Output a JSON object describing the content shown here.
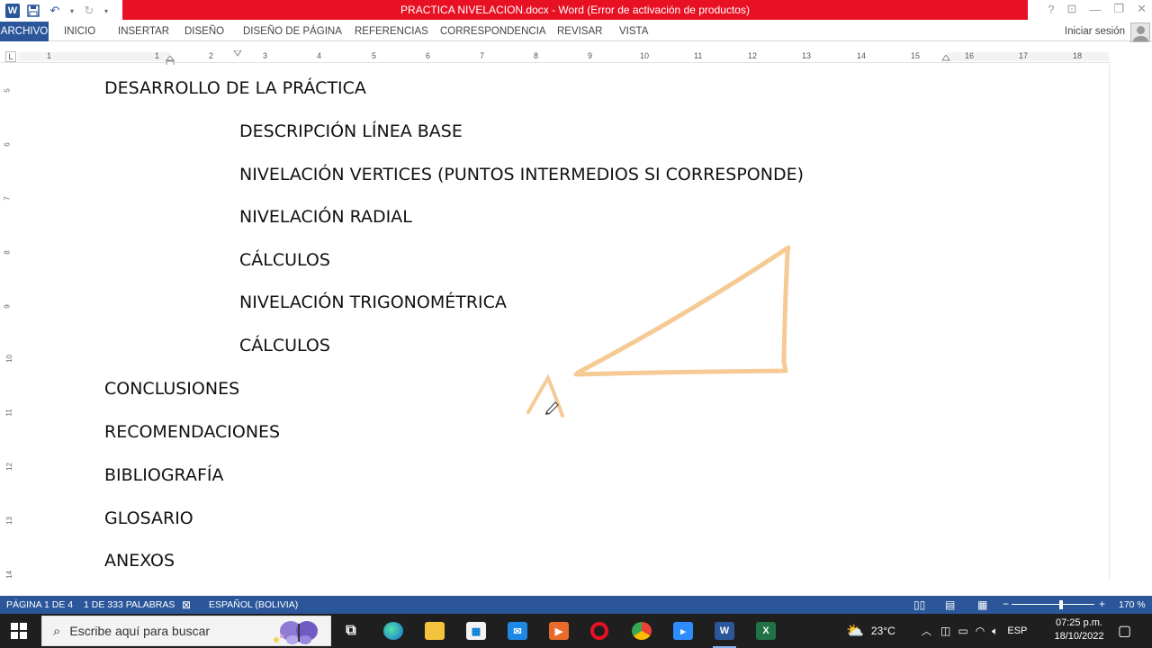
{
  "window": {
    "title": "PRACTICA NIVELACION.docx -  Word (Error de activación de productos)",
    "help": "?"
  },
  "ribbon": {
    "tabs": [
      "ARCHIVO",
      "INICIO",
      "INSERTAR",
      "DISEÑO",
      "DISEÑO DE PÁGINA",
      "REFERENCIAS",
      "CORRESPONDENCIA",
      "REVISAR",
      "VISTA"
    ],
    "signin": "Iniciar sesión"
  },
  "ruler": {
    "corner": "L",
    "numbers": [
      "1",
      "1",
      "2",
      "3",
      "4",
      "5",
      "6",
      "7",
      "8",
      "9",
      "10",
      "11",
      "12",
      "13",
      "14",
      "15",
      "16",
      "17",
      "18"
    ],
    "vertical_numbers": [
      "5",
      "6",
      "7",
      "8",
      "9",
      "10",
      "11",
      "12",
      "13",
      "14"
    ]
  },
  "document": {
    "lines": [
      {
        "text": "DESARROLLO DE LA PRÁCTICA",
        "level": 0
      },
      {
        "text": "DESCRIPCIÓN LÍNEA BASE",
        "level": 1
      },
      {
        "text": "NIVELACIÓN VERTICES (PUNTOS INTERMEDIOS SI CORRESPONDE)",
        "level": 1
      },
      {
        "text": "NIVELACIÓN RADIAL",
        "level": 1
      },
      {
        "text": "CÁLCULOS",
        "level": 1
      },
      {
        "text": "NIVELACIÓN TRIGONOMÉTRICA",
        "level": 1
      },
      {
        "text": "CÁLCULOS",
        "level": 1
      },
      {
        "text": "CONCLUSIONES",
        "level": 0
      },
      {
        "text": "RECOMENDACIONES",
        "level": 0
      },
      {
        "text": "BIBLIOGRAFÍA",
        "level": 0
      },
      {
        "text": "GLOSARIO",
        "level": 0
      },
      {
        "text": "ANEXOS",
        "level": 0
      }
    ],
    "ink_color": "#f5c48a"
  },
  "statusbar": {
    "page": "PÁGINA 1 DE 4",
    "words": "1 DE 333 PALABRAS",
    "language": "ESPAÑOL (BOLIVIA)",
    "zoom_minus": "−",
    "zoom_plus": "+",
    "zoom": "170 %"
  },
  "taskbar": {
    "search_placeholder": "Escribe aquí para buscar",
    "apps": [
      "task-view",
      "edge",
      "file-explorer",
      "store",
      "mail",
      "media-player",
      "opera",
      "chrome",
      "zoom",
      "word",
      "excel"
    ],
    "temperature": "23°C",
    "input_lang": "ESP",
    "time": "07:25 p.m.",
    "date": "18/10/2022"
  },
  "colors": {
    "word_blue": "#2b579a",
    "title_red": "#e81123",
    "taskbar": "#1f1f1f"
  }
}
